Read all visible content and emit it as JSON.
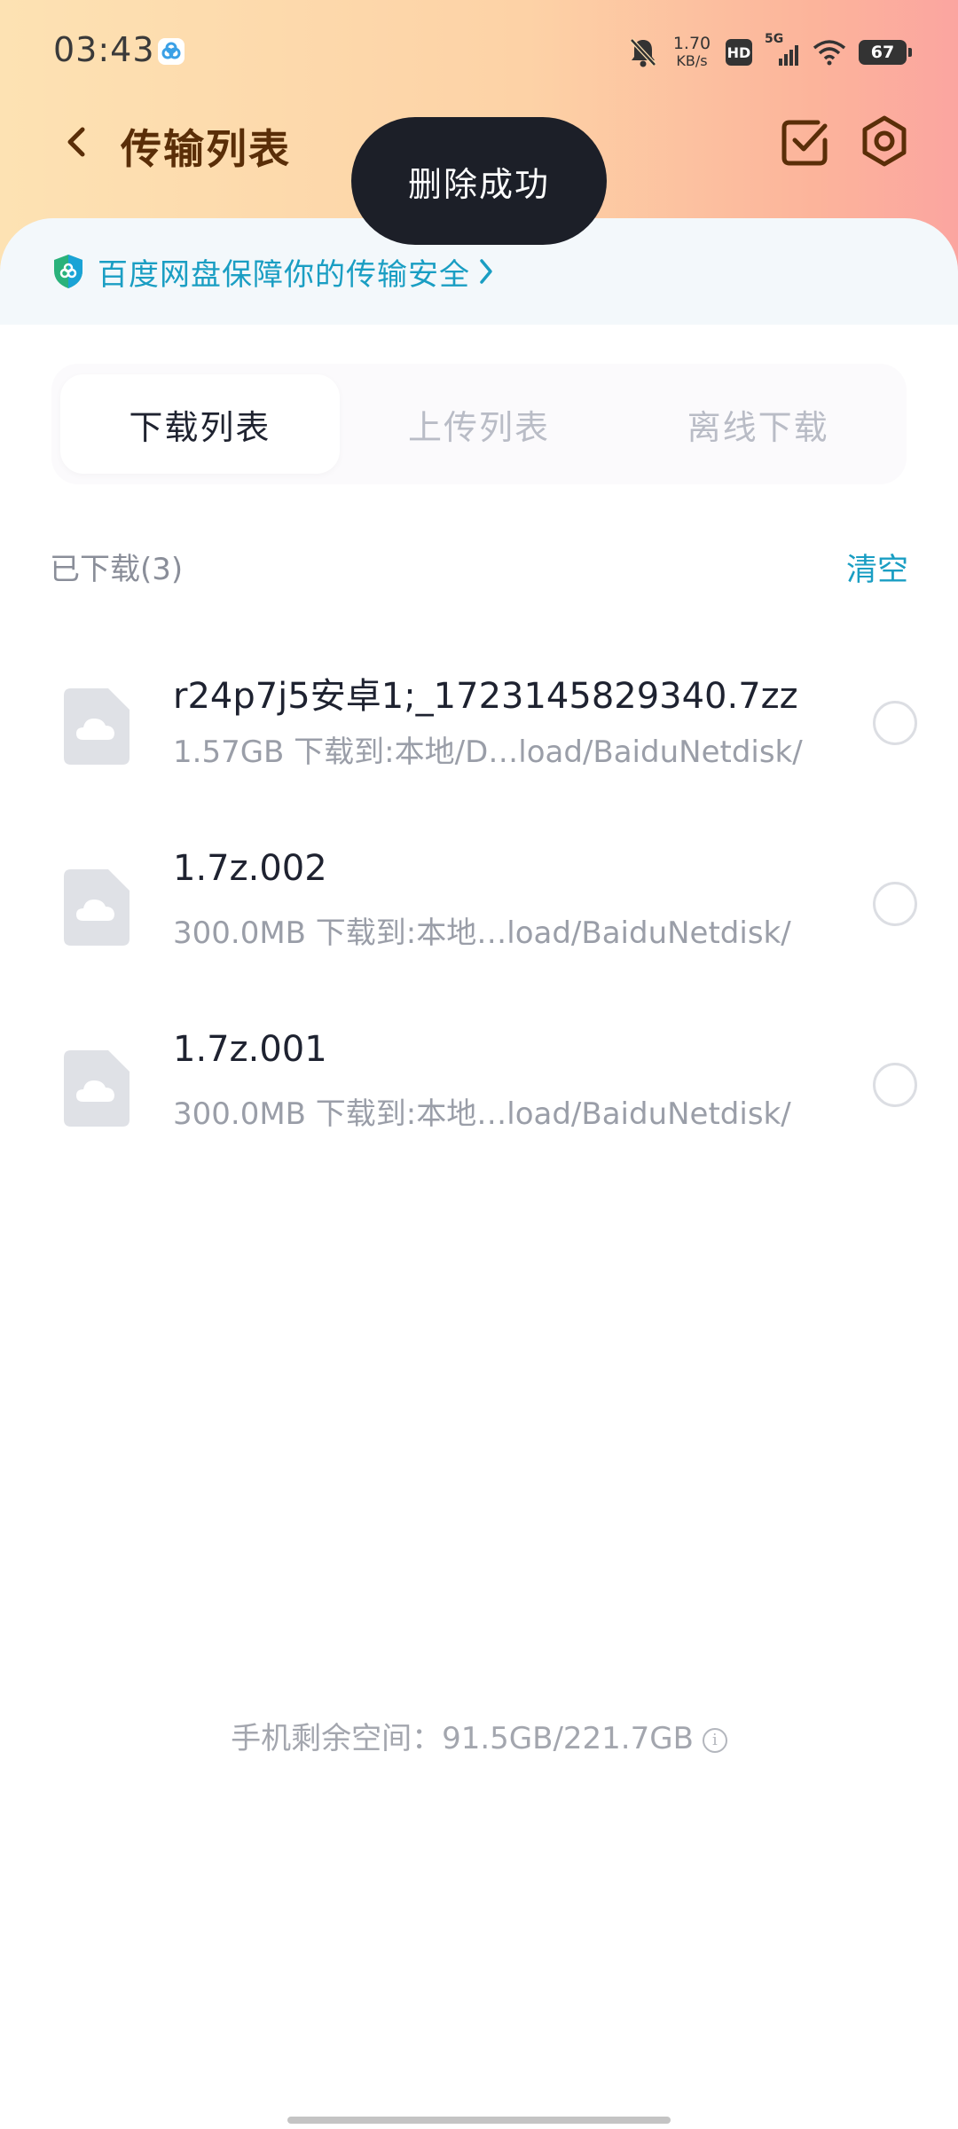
{
  "status_bar": {
    "time": "03:43",
    "net_speed_value": "1.70",
    "net_speed_unit": "KB/s",
    "hd_label": "HD",
    "network_label": "5G",
    "battery": "67"
  },
  "header": {
    "title": "传输列表",
    "icons": [
      "back-arrow-icon",
      "multi-select-check-icon",
      "settings-gear-icon"
    ]
  },
  "toast": {
    "text": "删除成功"
  },
  "banner": {
    "text": "百度网盘保障你的传输安全",
    "accent_color": "#1a9ec3"
  },
  "tabs": [
    {
      "label": "下载列表",
      "active": true
    },
    {
      "label": "上传列表",
      "active": false
    },
    {
      "label": "离线下载",
      "active": false
    }
  ],
  "section": {
    "title": "已下载(3)",
    "clear_label": "清空"
  },
  "files": [
    {
      "name": "r24p7j5安卓1;_1723145829340.7zz",
      "meta": "1.57GB 下载到:本地/D…load/BaiduNetdisk/"
    },
    {
      "name": "1.7z.002",
      "meta": "300.0MB 下载到:本地…load/BaiduNetdisk/"
    },
    {
      "name": "1.7z.001",
      "meta": "300.0MB 下载到:本地…load/BaiduNetdisk/"
    }
  ],
  "footer": {
    "storage": "手机剩余空间：91.5GB/221.7GB",
    "info_glyph": "i"
  }
}
